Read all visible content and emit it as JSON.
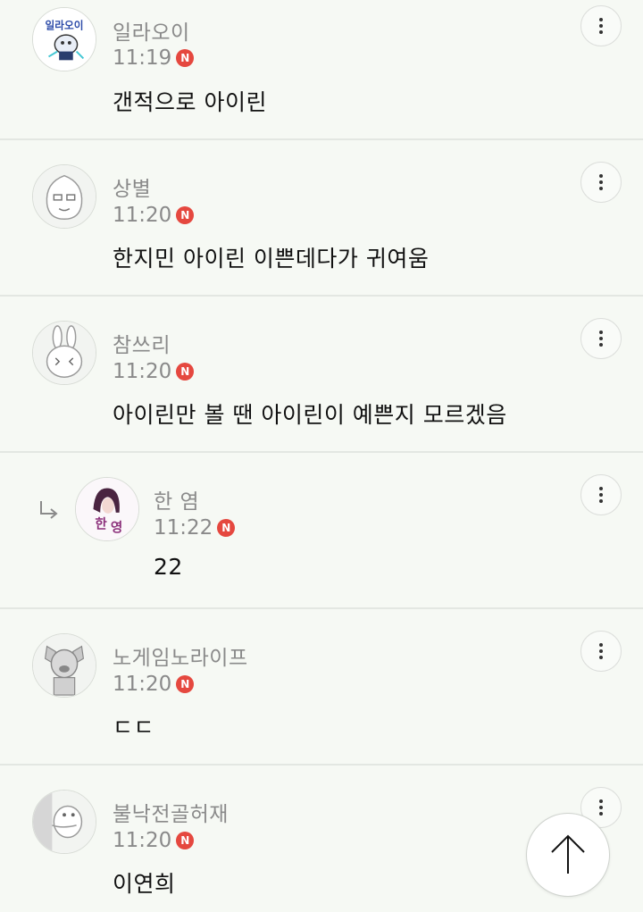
{
  "comments": [
    {
      "author": "일라오이",
      "time": "11:19",
      "badge": "N",
      "text": "갠적으로 아이린",
      "avatar_icon": "sticker-avatar-icon"
    },
    {
      "author": "상별",
      "time": "11:20",
      "badge": "N",
      "text": "한지민 아이린 이쁜데다가 귀여움",
      "avatar_icon": "peach-face-avatar-icon"
    },
    {
      "author": "참쓰리",
      "time": "11:20",
      "badge": "N",
      "text": "아이린만 볼 땐 아이린이 예쁜지 모르겠음",
      "avatar_icon": "rabbit-avatar-icon"
    },
    {
      "author": "한 염",
      "time": "11:22",
      "badge": "N",
      "text": "22",
      "avatar_icon": "photo-avatar-icon",
      "is_reply": true
    },
    {
      "author": "노게임노라이프",
      "time": "11:20",
      "badge": "N",
      "text": "ㄷㄷ",
      "avatar_icon": "dog-avatar-icon"
    },
    {
      "author": "불낙전골허재",
      "time": "11:20",
      "badge": "N",
      "text": "이연희",
      "avatar_icon": "peeking-character-avatar-icon"
    }
  ],
  "colors": {
    "background": "#f6f9f4",
    "badge": "#e5483f",
    "meta_text": "#8a8a8a",
    "body_text": "#111111"
  },
  "icons": {
    "more": "vertical-ellipsis-icon",
    "reply": "reply-arrow-icon",
    "scroll_top": "arrow-up-icon"
  }
}
